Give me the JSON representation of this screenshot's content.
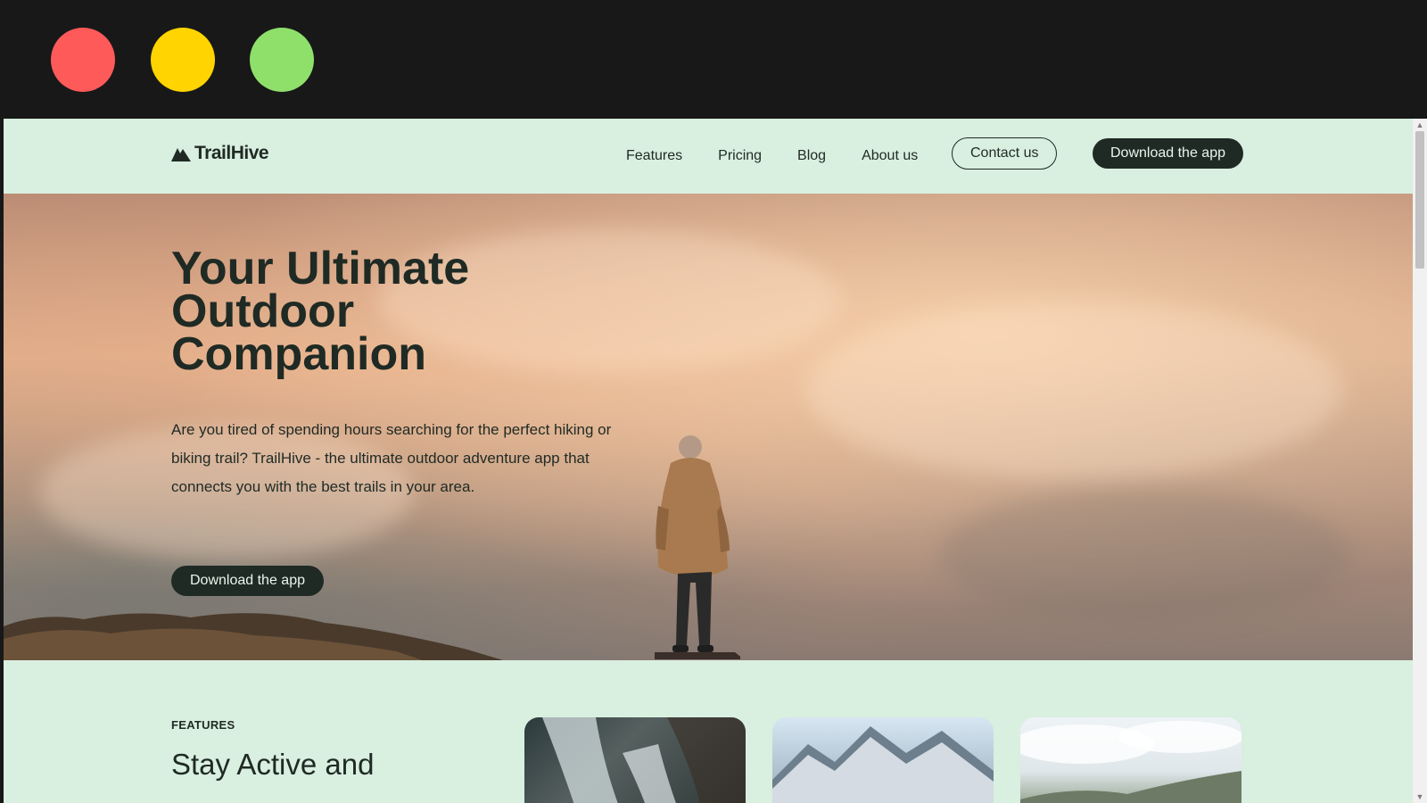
{
  "window": {
    "controls": [
      "close",
      "minimize",
      "maximize"
    ]
  },
  "nav": {
    "logo_text": "TrailHive",
    "links": [
      "Features",
      "Pricing",
      "Blog",
      "About us"
    ],
    "contact_label": "Contact us",
    "download_label": "Download the app"
  },
  "hero": {
    "title": "Your Ultimate Outdoor Companion",
    "description": "Are you tired of spending hours searching for the perfect hiking or biking trail? TrailHive - the ultimate outdoor adventure app that connects you with the best trails in your area.",
    "button_label": "Download the app"
  },
  "features": {
    "label": "FEATURES",
    "heading": "Stay Active and"
  },
  "colors": {
    "page_bg": "#d9efe0",
    "dark": "#1f2a24",
    "close": "#ff5a5a",
    "minimize": "#ffd400",
    "maximize": "#8ee06b"
  }
}
